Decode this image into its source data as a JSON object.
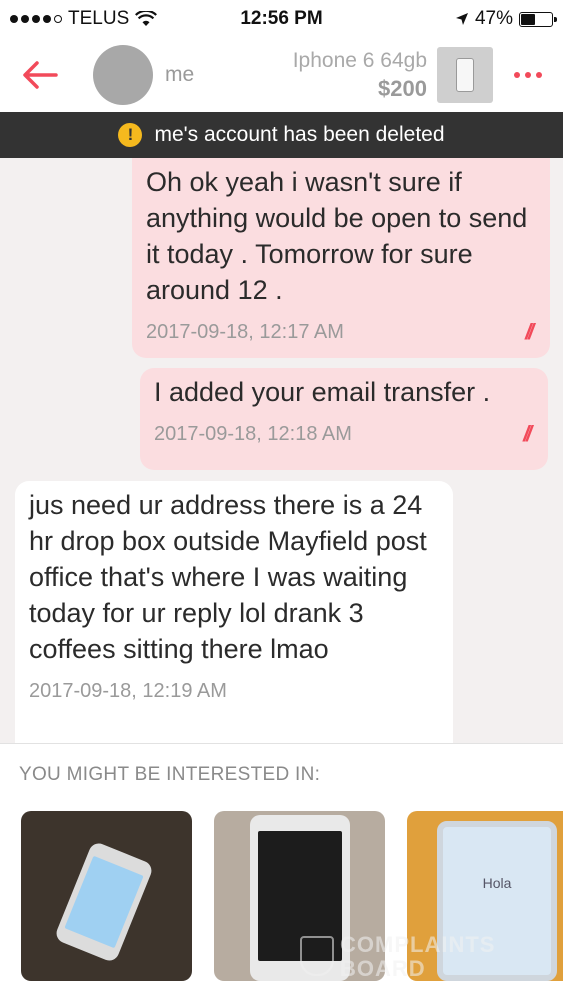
{
  "status_bar": {
    "carrier": "TELUS",
    "time": "12:56 PM",
    "battery": "47%",
    "battery_level": 0.47
  },
  "header": {
    "back_icon": "arrow-left-icon",
    "contact_name": "me",
    "listing_title": "Iphone 6 64gb",
    "listing_price": "$200",
    "more_icon": "more-dots-icon",
    "accent_color": "#f24a5a"
  },
  "notice": {
    "icon": "warning-icon",
    "text": "me's account has been deleted"
  },
  "messages": [
    {
      "direction": "outgoing",
      "text": "Oh ok yeah i wasn't sure if anything would be open to send it today . Tomorrow for sure around 12 .",
      "timestamp": "2017-09-18, 12:17 AM"
    },
    {
      "direction": "outgoing",
      "text": "I added your email transfer .",
      "timestamp": "2017-09-18, 12:18 AM"
    },
    {
      "direction": "incoming",
      "text": "jus need ur address there is a 24 hr drop box outside Mayfield post office that's where I was waiting today for ur reply lol drank 3 coffees sitting there lmao",
      "timestamp": "2017-09-18, 12:19 AM"
    }
  ],
  "suggestions": {
    "title": "YOU MIGHT BE INTERESTED IN:",
    "items": [
      {
        "label": ""
      },
      {
        "label": ""
      },
      {
        "label": "Hola"
      }
    ]
  },
  "watermark": {
    "line1": "COMPLAINTS",
    "line2": "BOARD"
  }
}
